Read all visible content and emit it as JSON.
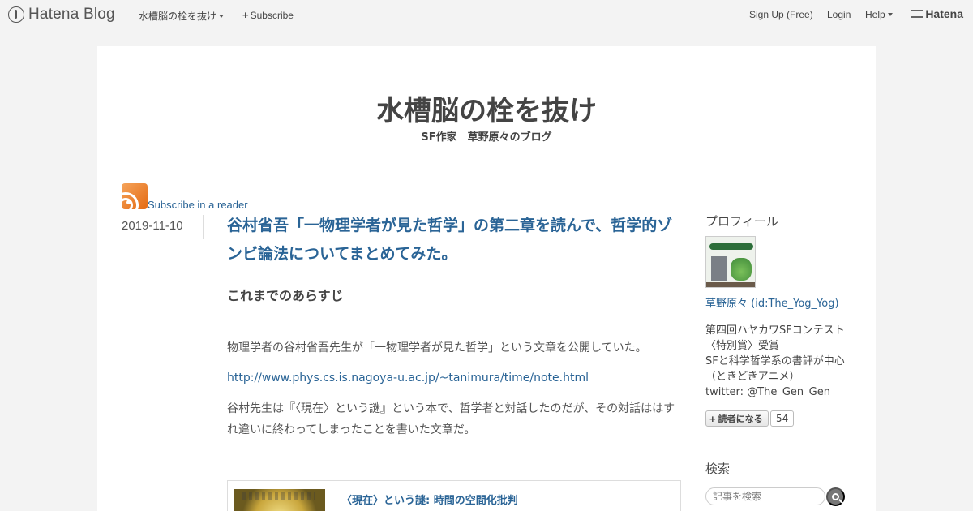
{
  "topbar": {
    "brand": "Hatena Blog",
    "blog_menu": "水槽脳の栓を抜け",
    "subscribe": "Subscribe",
    "signup": "Sign Up (Free)",
    "login": "Login",
    "help": "Help",
    "hatena": "Hatena"
  },
  "blog": {
    "title": "水槽脳の栓を抜け",
    "description": "SF作家　草野原々のブログ"
  },
  "rss": {
    "label": "Subscribe in a reader"
  },
  "entry": {
    "date": "2019-11-10",
    "title": "谷村省吾「一物理学者が見た哲学」の第二章を読んで、哲学的ゾンビ論法についてまとめてみた。",
    "heading": "これまでのあらすじ",
    "paragraph1": "物理学者の谷村省吾先生が「一物理学者が見た哲学」という文章を公開していた。",
    "link": "http://www.phys.cs.is.nagoya-u.ac.jp/~tanimura/time/note.html",
    "paragraph2": "谷村先生は『〈現在〉という謎』という本で、哲学者と対話したのだが、その対話ははすれ違いに終わってしまったことを書いた文章だ。",
    "embed_title": "〈現在〉という謎: 時間の空間化批判"
  },
  "sidebar": {
    "profile_heading": "プロフィール",
    "profile_name": "草野原々 (id:The_Yog_Yog)",
    "bio": [
      "第四回ハヤカワSFコンテスト",
      "〈特別賞〉受賞",
      "SFと科学哲学系の書評が中心",
      "（ときどきアニメ）",
      "twitter: @The_Gen_Gen"
    ],
    "subscribe_button": "読者になる",
    "subscriber_count": "54",
    "search_heading": "検索",
    "search_placeholder": "記事を検索"
  },
  "colors": {
    "link": "#2a6496",
    "background": "#f3f3f3",
    "rss": "#e46a12"
  }
}
